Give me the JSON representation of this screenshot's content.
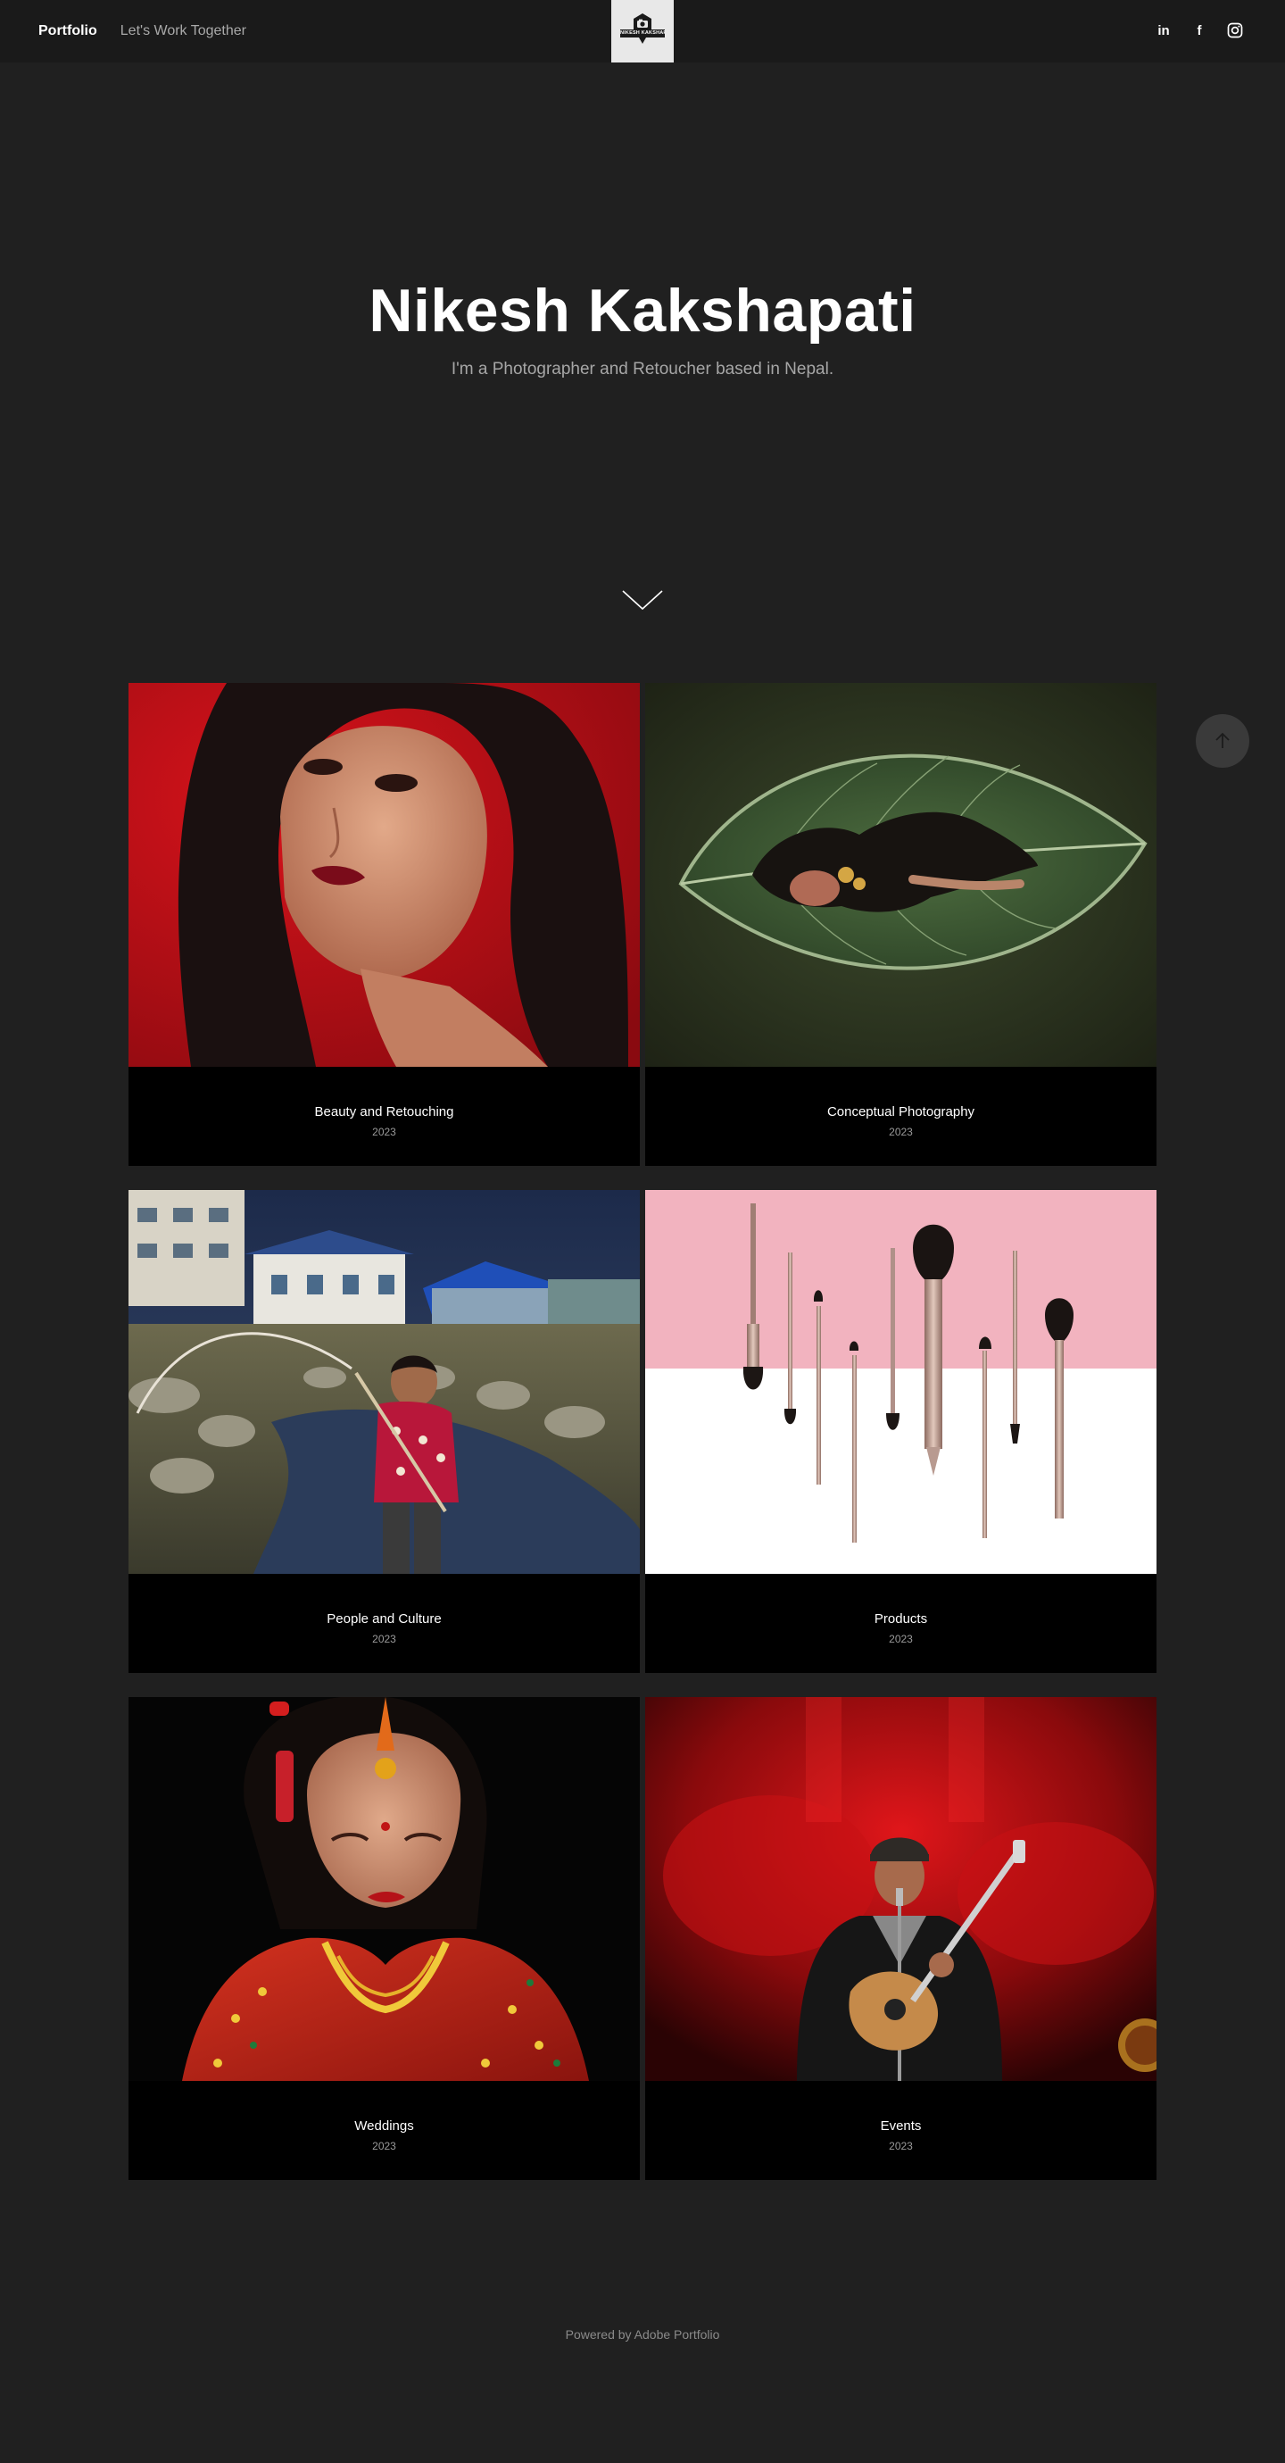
{
  "nav": {
    "links": [
      {
        "label": "Portfolio"
      },
      {
        "label": "Let's Work Together"
      }
    ],
    "logo": {
      "text": "NIKESH KAKSHAPATI"
    },
    "social": [
      {
        "name": "linkedin-icon",
        "glyph": "in"
      },
      {
        "name": "facebook-icon",
        "glyph": "f"
      },
      {
        "name": "instagram-icon",
        "glyph": ""
      }
    ]
  },
  "hero": {
    "title": "Nikesh Kakshapati",
    "subtitle": "I'm a Photographer and Retoucher based in Nepal."
  },
  "projects": [
    {
      "title": "Beauty and Retouching",
      "year": "2023"
    },
    {
      "title": "Conceptual Photography",
      "year": "2023"
    },
    {
      "title": "People and Culture",
      "year": "2023"
    },
    {
      "title": "Products",
      "year": "2023"
    },
    {
      "title": "Weddings",
      "year": "2023"
    },
    {
      "title": "Events",
      "year": "2023"
    }
  ],
  "footer": {
    "text": "Powered by Adobe Portfolio"
  },
  "colors": {
    "page_bg": "#202020",
    "nav_bg": "#1a1a1a",
    "card_bg": "#000000",
    "muted_text": "#a6a6a6"
  }
}
